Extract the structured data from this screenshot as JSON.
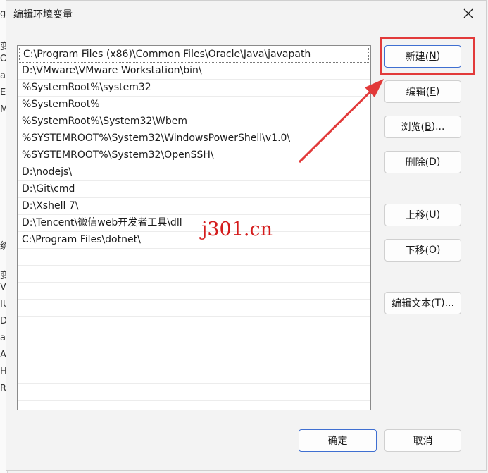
{
  "dialog": {
    "title": "编辑环境变量",
    "close_icon": "close-icon"
  },
  "paths": [
    "C:\\Program Files (x86)\\Common Files\\Oracle\\Java\\javapath",
    "D:\\VMware\\VMware Workstation\\bin\\",
    "%SystemRoot%\\system32",
    "%SystemRoot%",
    "%SystemRoot%\\System32\\Wbem",
    "%SYSTEMROOT%\\System32\\WindowsPowerShell\\v1.0\\",
    "%SYSTEMROOT%\\System32\\OpenSSH\\",
    "D:\\nodejs\\",
    "D:\\Git\\cmd",
    "D:\\Xshell 7\\",
    "D:\\Tencent\\微信web开发者工具\\dll",
    "C:\\Program Files\\dotnet\\"
  ],
  "empty_rows": 9,
  "buttons": {
    "new": {
      "label": "新建(",
      "key": "N",
      "tail": ")"
    },
    "edit": {
      "label": "编辑(",
      "key": "E",
      "tail": ")"
    },
    "browse": {
      "label": "浏览(",
      "key": "B",
      "tail": ")..."
    },
    "delete": {
      "label": "删除(",
      "key": "D",
      "tail": ")"
    },
    "move_up": {
      "label": "上移(",
      "key": "U",
      "tail": ")"
    },
    "move_down": {
      "label": "下移(",
      "key": "O",
      "tail": ")"
    },
    "edit_text": {
      "label": "编辑文本(",
      "key": "T",
      "tail": ")..."
    },
    "ok": "确定",
    "cancel": "取消"
  },
  "annotation": {
    "highlight_color": "#e23a3a",
    "watermark": "j301.cn"
  },
  "background_window": {
    "fragments": [
      "g",
      "变",
      "Or",
      "a",
      "E",
      "M",
      "统",
      "变",
      "V",
      "IU",
      "DS",
      "a",
      "A",
      "H",
      "R"
    ]
  }
}
